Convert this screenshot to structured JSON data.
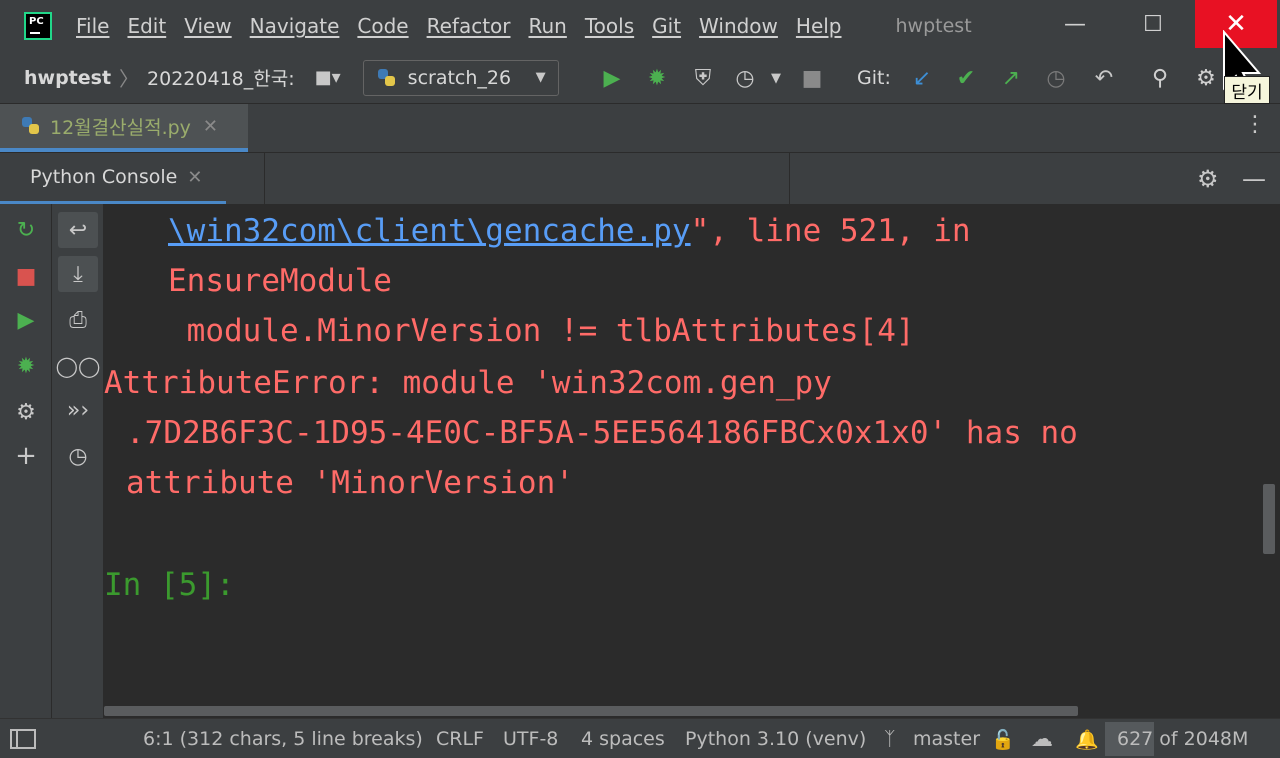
{
  "app": {
    "logo_text": "PC",
    "window_title": "hwptest"
  },
  "menu": [
    "File",
    "Edit",
    "View",
    "Navigate",
    "Code",
    "Refactor",
    "Run",
    "Tools",
    "Git",
    "Window",
    "Help"
  ],
  "window_controls": {
    "minimize": "—",
    "maximize": "☐",
    "close": "✕"
  },
  "navbar": {
    "project": "hwptest",
    "path": "20220418_한국:",
    "run_config": "scratch_26",
    "git_label": "Git:"
  },
  "editor_tab": {
    "name": "12월결산실적.py"
  },
  "tool_window": {
    "tab": "Python Console"
  },
  "console": {
    "link": "\\win32com\\client\\gencache.py",
    "line1_rest": "\", line 521, in",
    "line2": "EnsureModule",
    "line3": " module.MinorVersion != tlbAttributes[4]",
    "line4": "AttributeError: module 'win32com.gen_py",
    "line5": ".7D2B6F3C-1D95-4E0C-BF5A-5EE564186FBCx0x1x0' has no",
    "line6": "attribute 'MinorVersion'",
    "prompt": "In [5]:"
  },
  "status": {
    "position": "6:1 (312 chars, 5 line breaks)",
    "line_sep": "CRLF",
    "encoding": "UTF-8",
    "indent": "4 spaces",
    "interpreter": "Python 3.10 (venv)",
    "branch": "master",
    "memory": "627 of 2048M",
    "memory_used_fraction": 0.306
  },
  "tooltip": "닫기",
  "colors": {
    "accent": "#4a88c7",
    "error": "#ff6b68",
    "link": "#589df6",
    "prompt": "#3b9a2e",
    "close": "#e81123"
  }
}
